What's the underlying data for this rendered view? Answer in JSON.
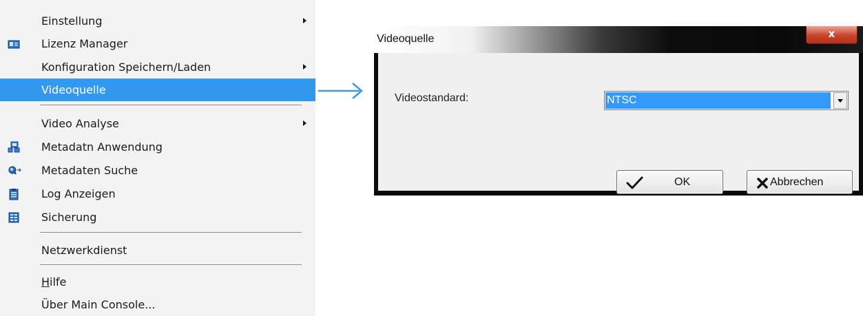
{
  "menu": {
    "items": [
      {
        "label": "Einstellung",
        "submenu": true
      },
      {
        "label": "Lizenz Manager",
        "icon": "license-icon"
      },
      {
        "label": "Konfiguration Speichern/Laden",
        "submenu": true
      },
      {
        "label": "Videoquelle",
        "selected": true
      },
      {
        "label": "Video Analyse",
        "submenu": true
      },
      {
        "label": "Metadatn Anwendung",
        "icon": "metadata-app-icon"
      },
      {
        "label": "Metadaten Suche",
        "icon": "search-icon"
      },
      {
        "label": "Log Anzeigen",
        "icon": "clipboard-icon"
      },
      {
        "label": "Sicherung",
        "icon": "backup-icon"
      },
      {
        "label": "Netzwerkdienst"
      },
      {
        "label_first": "H",
        "label_rest": "ilfe"
      },
      {
        "label": "Über Main Console..."
      }
    ],
    "selected_color": "#3399ee"
  },
  "dialog": {
    "title": "Videoquelle",
    "close_label": "x",
    "field_label": "Videostandard:",
    "select_value": "NTSC",
    "ok_label": "OK",
    "cancel_label": "Abbrechen",
    "highlight_color": "#3399ff",
    "close_color": "#c9432b"
  },
  "arrow_color": "#3b9ae1"
}
